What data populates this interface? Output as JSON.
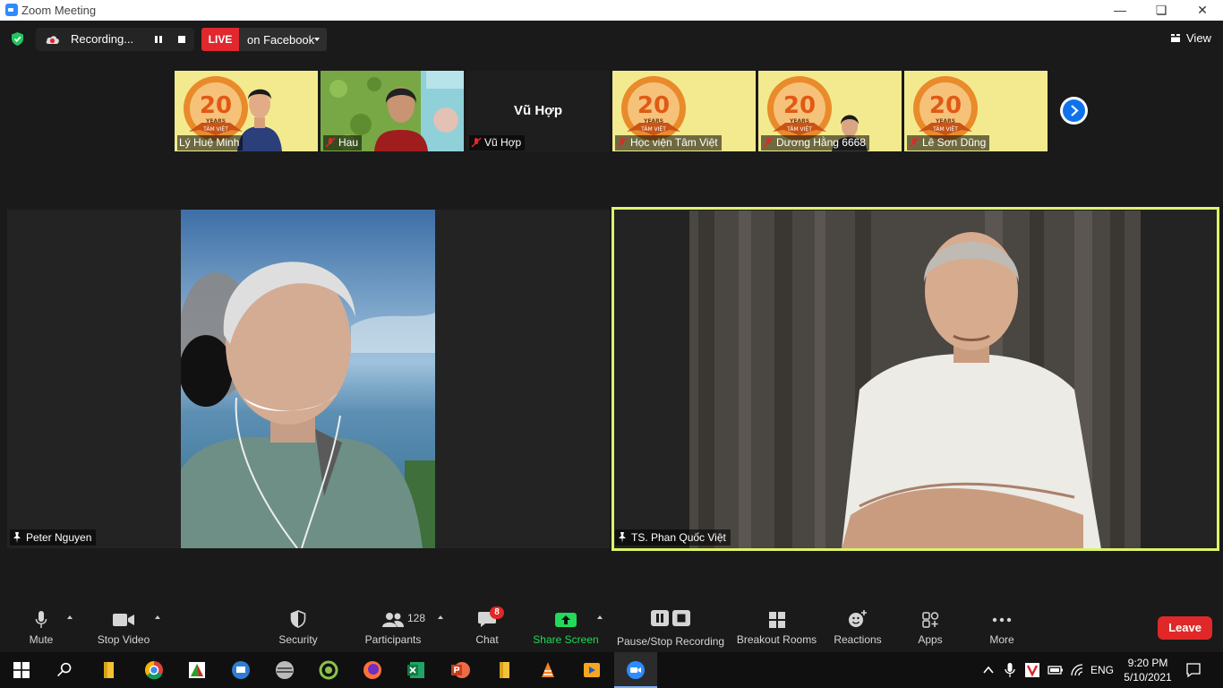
{
  "window": {
    "title": "Zoom Meeting"
  },
  "topbar": {
    "recording_label": "Recording...",
    "live_badge": "LIVE",
    "live_target": "on Facebook",
    "view_label": "View"
  },
  "filmstrip": [
    {
      "name": "Lý Huệ Minh",
      "muted": false
    },
    {
      "name": "Hau",
      "muted": true
    },
    {
      "name": "Vũ Hợp",
      "muted": true,
      "center_label": "Vũ Hợp"
    },
    {
      "name": "Học viện Tâm Việt",
      "muted": true
    },
    {
      "name": "Dương Hằng 6668",
      "muted": true
    },
    {
      "name": "Lê Sơn Dũng",
      "muted": true
    }
  ],
  "badge_text": {
    "big": "20",
    "years": "YEARS",
    "brand": "TÂM VIỆT"
  },
  "main": {
    "left_name": "Peter Nguyen",
    "right_name": "TS. Phan Quốc Việt"
  },
  "toolbar": {
    "mute": "Mute",
    "stop_video": "Stop Video",
    "security": "Security",
    "participants": "Participants",
    "participants_count": "128",
    "chat": "Chat",
    "chat_badge": "8",
    "share_screen": "Share Screen",
    "pause_recording": "Pause/Stop Recording",
    "breakout": "Breakout Rooms",
    "reactions": "Reactions",
    "apps": "Apps",
    "more": "More",
    "leave": "Leave"
  },
  "taskbar": {
    "lang": "ENG",
    "time": "9:20 PM",
    "date": "5/10/2021"
  },
  "colors": {
    "active_speaker_border": "#ddf36a",
    "live_red": "#e0282e",
    "share_green": "#23d959",
    "leave_red": "#e02828"
  }
}
